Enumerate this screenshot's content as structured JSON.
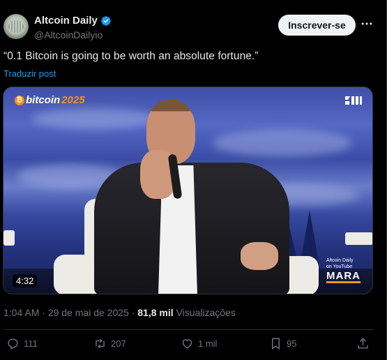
{
  "author": {
    "name": "Altcoin Daily",
    "handle": "@AltcoinDailyio"
  },
  "follow_button": "Inscrever-se",
  "tweet": {
    "text": "“0.1 Bitcoin is going to be worth an absolute fortune.”",
    "translate_label": "Traduzir post"
  },
  "video": {
    "event_logo_prefix": "bitcoin",
    "event_logo_year": "2025",
    "overlay_line1": "Altcoin Daily",
    "overlay_line2": "on YouTube",
    "sponsor": "MARA",
    "duration": "4:32"
  },
  "meta": {
    "time": "1:04 AM",
    "separator": "·",
    "date": "29 de mai de 2025",
    "views_count": "81,8 mil",
    "views_label": "Visualizações"
  },
  "actions": {
    "replies": "111",
    "reposts": "207",
    "likes": "1 mil",
    "bookmarks": "95"
  },
  "colors": {
    "accent": "#1d9bf0",
    "bitcoin_orange": "#f7931a",
    "background": "#000000"
  }
}
